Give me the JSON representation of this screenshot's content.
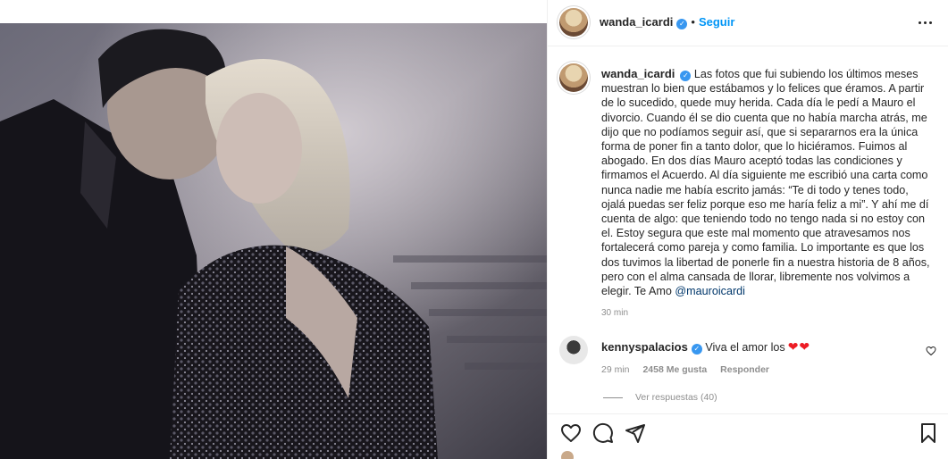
{
  "post": {
    "username": "wanda_icardi",
    "verified_mark": "✓",
    "separator": "•",
    "follow_label": "Seguir",
    "more_icon": "more-options-icon"
  },
  "caption": {
    "username": "wanda_icardi",
    "text": "Las fotos que fui subiendo los últimos meses muestran lo bien que estábamos y lo felices que éramos. A partir de lo sucedido, quede muy herida. Cada día le pedí a Mauro el divorcio. Cuando él se dio cuenta que no había marcha atrás, me dijo que no podíamos seguir así, que si separarnos era la única forma de poner fin a tanto dolor, que lo hiciéramos. Fuimos al abogado. En dos días Mauro aceptó todas las condiciones y firmamos el Acuerdo. Al día siguiente me escribió una carta como nunca nadie me había escrito jamás: “Te di todo y tenes todo, ojalá puedas ser feliz porque eso me haría feliz a mi”. Y ahí me dí cuenta de algo: que teniendo todo no tengo nada si no estoy con el. Estoy segura que este mal momento que atravesamos nos fortalecerá como pareja y como familia. Lo importante es que los dos tuvimos la libertad de ponerle fin a nuestra historia de 8 años, pero con el alma cansada de llorar, libremente nos volvimos a elegir. Te Amo",
    "mention": "@mauroicardi",
    "time": "30 min"
  },
  "comment": {
    "username": "kennyspalacios",
    "text": "Viva el amor los",
    "hearts": "❤❤",
    "time": "29 min",
    "likes": "2458 Me gusta",
    "reply_label": "Responder",
    "view_replies": "Ver respuestas (40)"
  },
  "actions": {
    "like_icon": "heart-icon",
    "comment_icon": "comment-icon",
    "share_icon": "share-icon",
    "save_icon": "bookmark-icon"
  },
  "colors": {
    "accent": "#0095f6",
    "verified": "#3897f0",
    "muted": "#8e8e8e",
    "text": "#262626",
    "mention": "#00376b",
    "heart": "#ed1c24"
  }
}
